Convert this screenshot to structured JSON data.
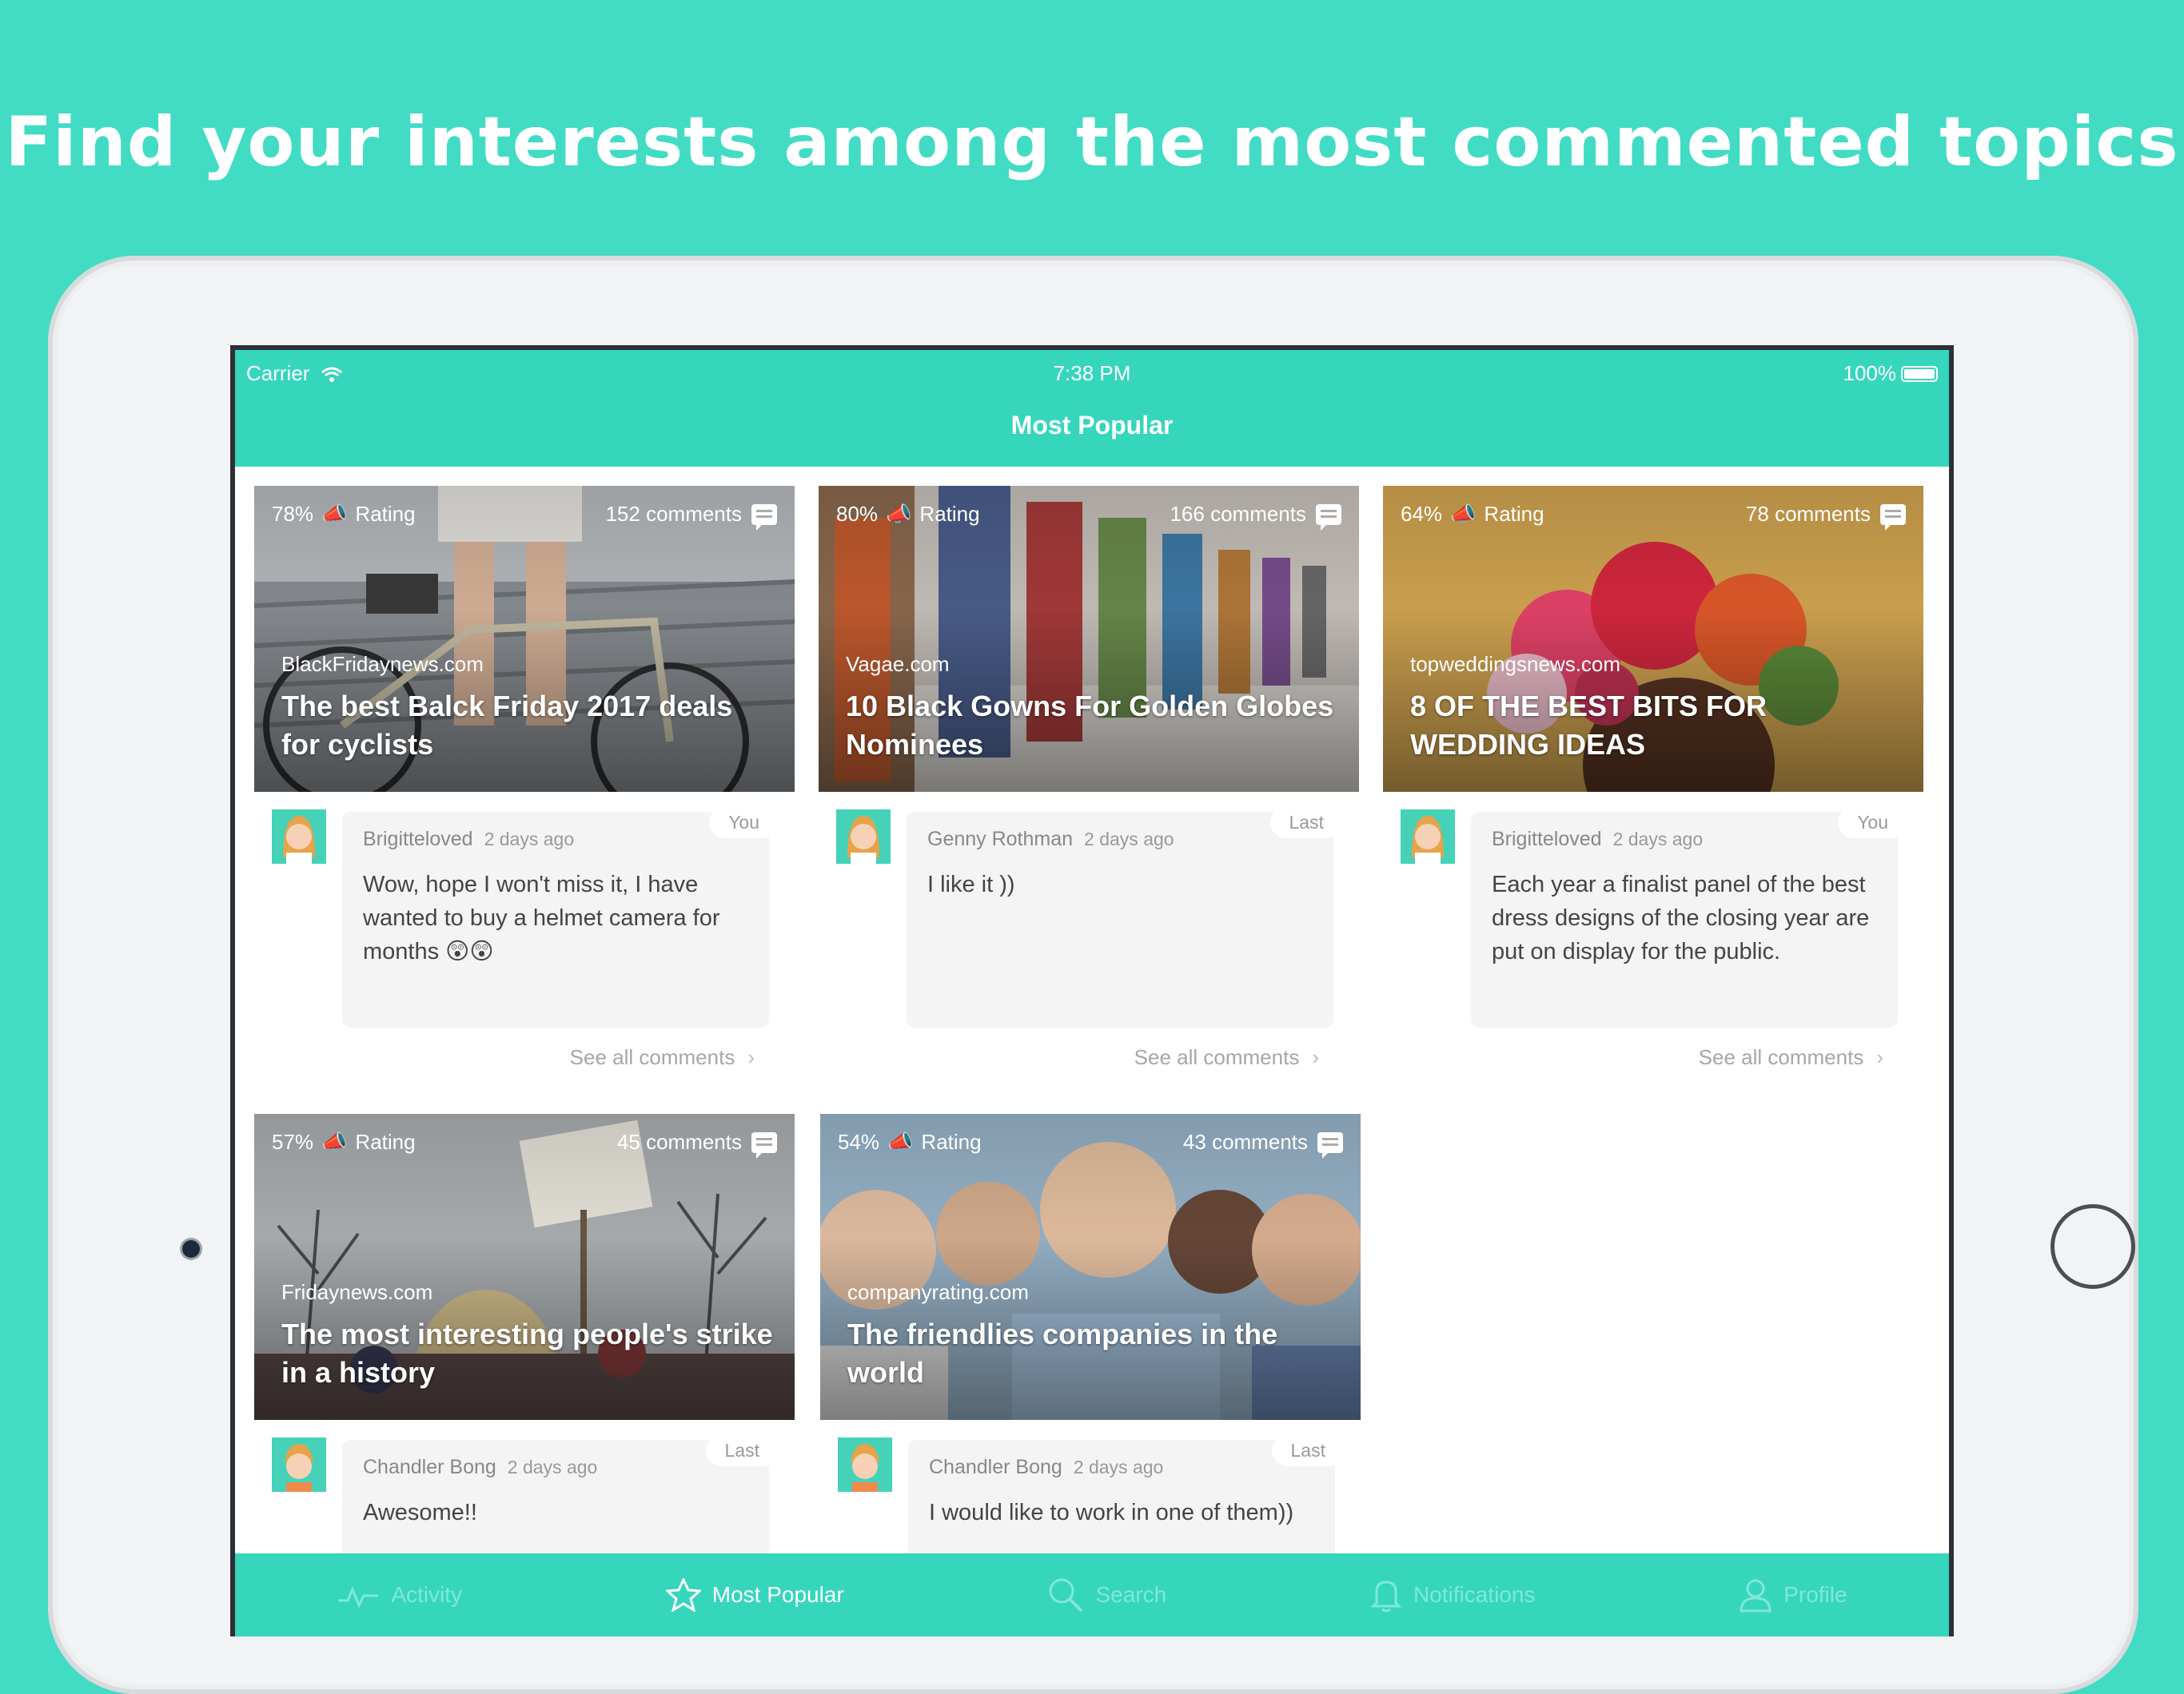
{
  "headline": "Find your interests among the most commented topics",
  "status_bar": {
    "carrier": "Carrier",
    "time": "7:38 PM",
    "battery": "100%"
  },
  "nav": {
    "title": "Most Popular"
  },
  "cards": [
    {
      "rating": "78%",
      "rating_label": "Rating",
      "comments": "152 comments",
      "source": "BlackFridaynews.com",
      "title": "The best Balck Friday 2017 deals for cyclists",
      "commenter": "Brigitteloved",
      "ago": "2 days ago",
      "tag": "You",
      "comment": "Wow, hope I won't miss it, I have wanted to buy a helmet camera for months 😲😲",
      "see_all": "See all comments"
    },
    {
      "rating": "80%",
      "rating_label": "Rating",
      "comments": "166 comments",
      "source": "Vagae.com",
      "title": "10 Black Gowns For Golden Globes Nominees",
      "commenter": "Genny Rothman",
      "ago": "2 days ago",
      "tag": "Last",
      "comment": "I like it ))",
      "see_all": "See all comments"
    },
    {
      "rating": "64%",
      "rating_label": "Rating",
      "comments": "78 comments",
      "source": "topweddingsnews.com",
      "title": "8 OF THE BEST BITS FOR WEDDING IDEAS",
      "commenter": "Brigitteloved",
      "ago": "2 days ago",
      "tag": "You",
      "comment": "Each year a finalist panel of the best dress designs of the closing year are put on display for the public.",
      "see_all": "See all comments"
    },
    {
      "rating": "57%",
      "rating_label": "Rating",
      "comments": "45 comments",
      "source": "Fridaynews.com",
      "title": "The most interesting people's strike in a history",
      "commenter": "Chandler Bong",
      "ago": "2 days ago",
      "tag": "Last",
      "comment": "Awesome!!",
      "see_all": ""
    },
    {
      "rating": "54%",
      "rating_label": "Rating",
      "comments": "43 comments",
      "source": "companyrating.com",
      "title": "The friendlies companies in the world",
      "commenter": "Chandler Bong",
      "ago": "2 days ago",
      "tag": "Last",
      "comment": "I would like to work in one of them))",
      "see_all": ""
    }
  ],
  "tabs": [
    {
      "label": "Activity",
      "icon": "activity-icon"
    },
    {
      "label": "Most Popular",
      "icon": "star-icon"
    },
    {
      "label": "Search",
      "icon": "search-icon"
    },
    {
      "label": "Notifications",
      "icon": "bell-icon"
    },
    {
      "label": "Profile",
      "icon": "person-icon"
    }
  ],
  "colors": {
    "background": "#41dcc3",
    "accent": "#36d6bd"
  }
}
